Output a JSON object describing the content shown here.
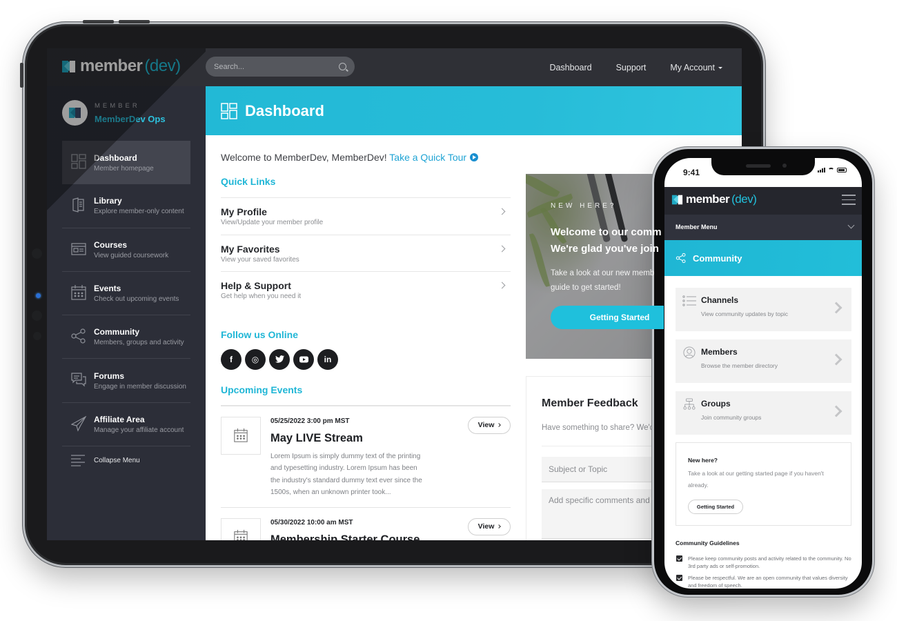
{
  "app": {
    "logo_main": "member",
    "logo_accent": "(dev)",
    "brand_color": "#22c0dc"
  },
  "topbar": {
    "search_placeholder": "Search...",
    "nav": [
      {
        "label": "Dashboard"
      },
      {
        "label": "Support"
      },
      {
        "label": "My Account",
        "icon": "caret-down-icon"
      }
    ]
  },
  "sidebar": {
    "member_label": "MEMBER",
    "member_name": "MemberDev Ops",
    "items": [
      {
        "title": "Dashboard",
        "subtitle": "Member homepage",
        "icon": "dashboard-icon",
        "active": true
      },
      {
        "title": "Library",
        "subtitle": "Explore member-only content",
        "icon": "book-icon"
      },
      {
        "title": "Courses",
        "subtitle": "View guided coursework",
        "icon": "courses-icon"
      },
      {
        "title": "Events",
        "subtitle": "Check out upcoming events",
        "icon": "calendar-icon"
      },
      {
        "title": "Community",
        "subtitle": "Members, groups and activity",
        "icon": "share-nodes-icon"
      },
      {
        "title": "Forums",
        "subtitle": "Engage in member discussion",
        "icon": "chat-icon"
      },
      {
        "title": "Affiliate Area",
        "subtitle": "Manage your affiliate account",
        "icon": "paper-plane-icon"
      }
    ],
    "collapse_label": "Collapse Menu"
  },
  "main": {
    "page_title": "Dashboard",
    "welcome_text": "Welcome to MemberDev, MemberDev! ",
    "tour_link": "Take a Quick Tour",
    "quick_links_heading": "Quick Links",
    "quick_links": [
      {
        "title": "My Profile",
        "subtitle": "View/Update your member profile"
      },
      {
        "title": "My Favorites",
        "subtitle": "View your saved favorites"
      },
      {
        "title": "Help & Support",
        "subtitle": "Get help when you need it"
      }
    ],
    "follow_heading": "Follow us Online",
    "social": [
      {
        "name": "facebook",
        "glyph": "f"
      },
      {
        "name": "instagram",
        "glyph": "◎"
      },
      {
        "name": "twitter",
        "glyph": "t"
      },
      {
        "name": "youtube",
        "glyph": "▶"
      },
      {
        "name": "linkedin",
        "glyph": "in"
      }
    ],
    "events_heading": "Upcoming Events",
    "events": [
      {
        "date": "05/25/2022 3:00 pm MST",
        "title": "May LIVE Stream",
        "description": "Lorem Ipsum is simply dummy text of the printing and typesetting industry. Lorem Ipsum has been the industry's standard dummy text ever since the 1500s, when an unknown printer took...",
        "button": "View"
      },
      {
        "date": "05/30/2022 10:00 am MST",
        "title": "Membership Starter Course",
        "description": "",
        "button": "View"
      }
    ],
    "promo": {
      "kicker": "NEW HERE?",
      "heading_line1": "Welcome to our comm",
      "heading_line2": "We're glad you've join",
      "body_line1": "Take a look at our new memb",
      "body_line2": "guide to get started!",
      "button": "Getting Started"
    },
    "feedback": {
      "heading": "Member Feedback",
      "prompt": "Have something to share? We'd l",
      "subject_placeholder": "Subject or Topic",
      "comments_placeholder": "Add specific comments and no"
    }
  },
  "phone": {
    "time": "9:41",
    "menu_label": "Member Menu",
    "page_title": "Community",
    "cards": [
      {
        "title": "Channels",
        "subtitle": "View community updates by topic",
        "icon": "list-icon"
      },
      {
        "title": "Members",
        "subtitle": "Browse the member directory",
        "icon": "user-circle-icon"
      },
      {
        "title": "Groups",
        "subtitle": "Join community groups",
        "icon": "hierarchy-icon"
      }
    ],
    "new_here": {
      "heading": "New here?",
      "text": "Take a look at our getting started page if you haven't already.",
      "button": "Getting Started"
    },
    "guidelines_heading": "Community Guidelines",
    "guidelines": [
      {
        "text": "Please keep community posts and activity related to the community. No 3rd party ads or self-promotion.",
        "checked": true
      },
      {
        "text": "Please be respectful. We are an open community that values diversity and freedom of speech.",
        "checked": true
      }
    ]
  }
}
